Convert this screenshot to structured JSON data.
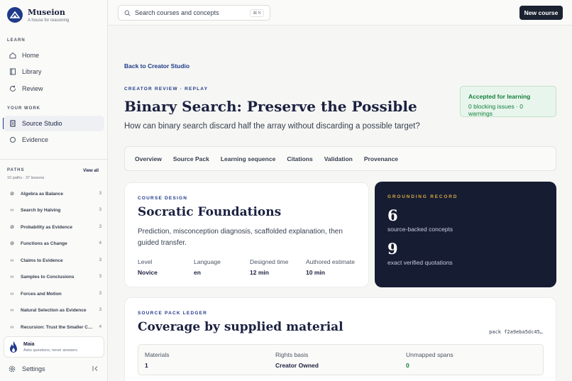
{
  "brand": {
    "name": "Museion",
    "tagline": "A house for reasoning"
  },
  "search": {
    "placeholder": "Search courses and concepts",
    "shortcut": "⌘ K"
  },
  "topbar": {
    "new_course_label": "New course"
  },
  "sidebar": {
    "learn_label": "LEARN",
    "learn_items": [
      {
        "label": "Home",
        "icon": "home-icon"
      },
      {
        "label": "Library",
        "icon": "book-icon"
      },
      {
        "label": "Review",
        "icon": "refresh-icon"
      }
    ],
    "work_label": "YOUR WORK",
    "work_items": [
      {
        "label": "Source Studio",
        "icon": "document-icon",
        "active": true
      },
      {
        "label": "Evidence",
        "icon": "circle-icon"
      }
    ],
    "paths_label": "PATHS",
    "view_all": "View all",
    "paths_meta": "10 paths · 37 lessons",
    "paths": [
      {
        "label": "Algebra as Balance",
        "count": "3"
      },
      {
        "label": "Search by Halving",
        "count": "3"
      },
      {
        "label": "Probability as Evidence",
        "count": "3"
      },
      {
        "label": "Functions as Change",
        "count": "4"
      },
      {
        "label": "Claims to Evidence",
        "count": "3"
      },
      {
        "label": "Samples to Conclusions",
        "count": "3"
      },
      {
        "label": "Forces and Motion",
        "count": "3"
      },
      {
        "label": "Natural Selection as Evidence",
        "count": "3"
      },
      {
        "label": "Recursion: Trust the Smaller Case",
        "count": "4"
      }
    ],
    "assistant": {
      "name": "Maia",
      "subtitle": "Asks questions, never answers"
    },
    "settings_label": "Settings"
  },
  "main": {
    "back_link": "Back to Creator Studio",
    "eyebrow": "CREATOR REVIEW · REPLAY",
    "title": "Binary Search: Preserve the Possible",
    "subtitle": "How can binary search discard half the array without discarding a possible target?",
    "status": {
      "title": "Accepted for learning",
      "detail": "0 blocking issues · 0 warnings",
      "color": "#15803d"
    },
    "tabs": [
      "Overview",
      "Source Pack",
      "Learning sequence",
      "Citations",
      "Validation",
      "Provenance"
    ],
    "design": {
      "eyebrow": "COURSE DESIGN",
      "title": "Socratic Foundations",
      "description": "Prediction, misconception diagnosis, scaffolded explanation, then guided transfer.",
      "facts": [
        {
          "label": "Level",
          "value": "Novice"
        },
        {
          "label": "Language",
          "value": "en"
        },
        {
          "label": "Designed time",
          "value": "12 min"
        },
        {
          "label": "Authored estimate",
          "value": "10 min"
        }
      ]
    },
    "grounding": {
      "eyebrow": "GROUNDING RECORD",
      "stats": [
        {
          "value": "6",
          "label": "source-backed concepts"
        },
        {
          "value": "9",
          "label": "exact verified quotations"
        }
      ]
    },
    "ledger": {
      "eyebrow": "SOURCE PACK LEDGER",
      "title": "Coverage by supplied material",
      "pack_id": "pack f2a9eba5dc45…",
      "columns": [
        {
          "label": "Materials",
          "value": "1"
        },
        {
          "label": "Rights basis",
          "value": "Creator Owned"
        },
        {
          "label": "Unmapped spans",
          "value": "0"
        }
      ]
    }
  },
  "colors": {
    "accent": "#1f3a8a",
    "success": "#15803d",
    "dark_card": "#161c32",
    "gold": "#d4a843"
  }
}
